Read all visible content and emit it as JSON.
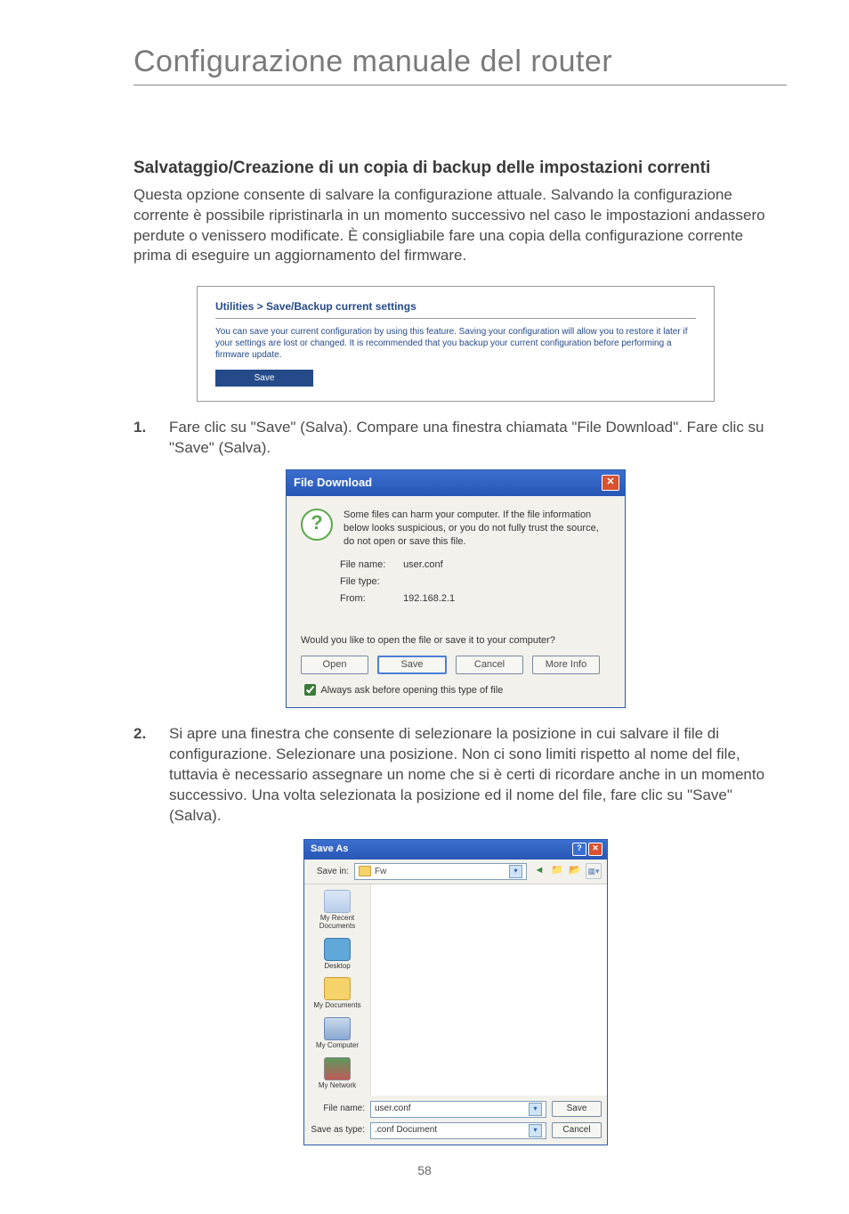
{
  "page": {
    "title": "Configurazione manuale del router",
    "number": "58"
  },
  "section": {
    "heading": "Salvataggio/Creazione di un copia di backup delle impostazioni correnti",
    "intro": "Questa opzione consente di salvare la configurazione attuale. Salvando la configurazione corrente è possibile ripristinarla in un momento successivo nel caso le impostazioni andassero perdute o venissero modificate. È consigliabile fare una copia della configurazione corrente prima di eseguire un aggiornamento del firmware."
  },
  "steps": [
    {
      "num": "1.",
      "text": "Fare clic su \"Save\" (Salva). Compare una finestra chiamata \"File Download\". Fare clic su \"Save\" (Salva)."
    },
    {
      "num": "2.",
      "text": "Si apre una finestra che consente di selezionare la posizione in cui salvare il file di configurazione. Selezionare una posizione. Non ci sono limiti rispetto al nome del file, tuttavia è necessario assegnare un nome che si è certi di ricordare anche in un momento successivo. Una volta selezionata la posizione ed il nome del file, fare clic su \"Save\" (Salva)."
    }
  ],
  "shot1": {
    "title": "Utilities > Save/Backup current settings",
    "desc": "You can save your current configuration by using this feature. Saving your configuration will allow you to restore it later if your settings are lost or changed. It is recommended that you backup your current configuration before performing a firmware update.",
    "save": "Save"
  },
  "shot2": {
    "title": "File Download",
    "warn": "Some files can harm your computer. If the file information below looks suspicious, or you do not fully trust the source, do not open or save this file.",
    "filename_lbl": "File name:",
    "filename": "user.conf",
    "filetype_lbl": "File type:",
    "filetype": "",
    "from_lbl": "From:",
    "from": "192.168.2.1",
    "question": "Would you like to open the file or save it to your computer?",
    "btn_open": "Open",
    "btn_save": "Save",
    "btn_cancel": "Cancel",
    "btn_more": "More Info",
    "always": "Always ask before opening this type of file"
  },
  "shot3": {
    "title": "Save As",
    "savein_lbl": "Save in:",
    "savein_value": "Fw",
    "places": {
      "recent": "My Recent Documents",
      "desktop": "Desktop",
      "docs": "My Documents",
      "comp": "My Computer",
      "net": "My Network"
    },
    "filename_lbl": "File name:",
    "filename": "user.conf",
    "savetype_lbl": "Save as type:",
    "savetype": ".conf Document",
    "btn_save": "Save",
    "btn_cancel": "Cancel"
  }
}
